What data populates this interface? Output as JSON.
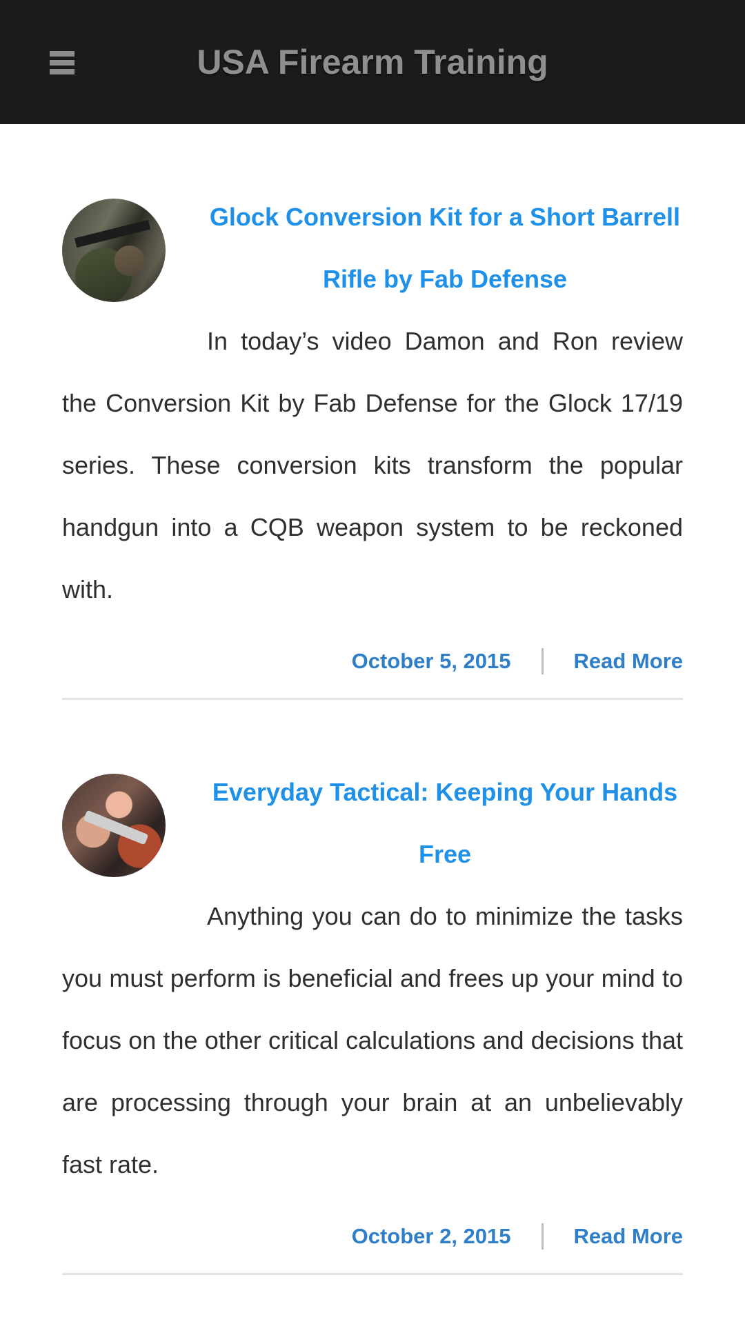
{
  "header": {
    "site_title": "USA Firearm Training",
    "menu_icon": "hamburger-menu-icon",
    "background_color": "#1b1b1b"
  },
  "posts": [
    {
      "title": "Glock Conversion Kit for a Short Barrell Rifle by Fab Defense",
      "excerpt": "In today’s video Damon and Ron review the Conversion Kit by Fab Defense for the Glock 17/19 series. These conversion kits transform the popular handgun into a CQB weapon system to be reckoned with.",
      "date": "October 5, 2015",
      "separator": "|",
      "read_more": "Read More"
    },
    {
      "title": "Everyday Tactical: Keeping Your Hands Free",
      "excerpt": "Anything you can do to minimize the tasks you must perform is beneficial and frees up your mind to focus on the other critical calculations and decisions that are processing through your brain at an unbelievably fast rate.",
      "date": "October 2, 2015",
      "separator": "|",
      "read_more": "Read More"
    }
  ],
  "colors": {
    "title_link": "#1e90e8",
    "meta_link": "#2f7fc8",
    "body_text": "#2f2f2f"
  }
}
